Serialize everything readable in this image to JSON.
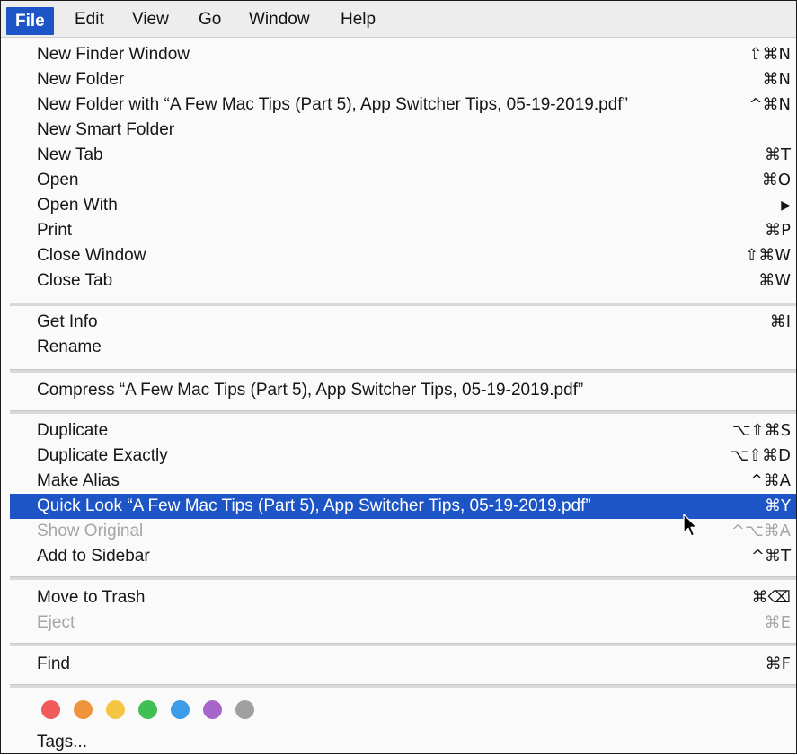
{
  "menubar": {
    "items": [
      "File",
      "Edit",
      "View",
      "Go",
      "Window",
      "Help"
    ],
    "active": "File"
  },
  "menu": {
    "items": [
      {
        "label": "New Finder Window",
        "shortcut": "⇧⌘N"
      },
      {
        "label": "New Folder",
        "shortcut": "⌘N"
      },
      {
        "label": "New Folder with “A Few Mac Tips (Part 5), App Switcher Tips, 05-19-2019.pdf”",
        "shortcut": "^⌘N"
      },
      {
        "label": "New Smart Folder",
        "shortcut": ""
      },
      {
        "label": "New Tab",
        "shortcut": "⌘T"
      },
      {
        "label": "Open",
        "shortcut": "⌘O"
      },
      {
        "label": "Open With",
        "shortcut": "▶"
      },
      {
        "label": "Print",
        "shortcut": "⌘P"
      },
      {
        "label": "Close Window",
        "shortcut": "⇧⌘W"
      },
      {
        "label": "Close Tab",
        "shortcut": "⌘W"
      },
      {
        "label": "Get Info",
        "shortcut": "⌘I"
      },
      {
        "label": "Rename",
        "shortcut": ""
      },
      {
        "label": "Compress “A Few Mac Tips (Part 5), App Switcher Tips, 05-19-2019.pdf”",
        "shortcut": ""
      },
      {
        "label": "Duplicate",
        "shortcut": "⌥⇧⌘S"
      },
      {
        "label": "Duplicate Exactly",
        "shortcut": "⌥⇧⌘D"
      },
      {
        "label": "Make Alias",
        "shortcut": "^⌘A"
      },
      {
        "label": "Quick Look “A Few Mac Tips (Part 5), App Switcher Tips, 05-19-2019.pdf”",
        "shortcut": "⌘Y",
        "state": "highlighted"
      },
      {
        "label": "Show Original",
        "shortcut": "^⌥⌘A",
        "state": "disabled"
      },
      {
        "label": "Add to Sidebar",
        "shortcut": "^⌘T"
      },
      {
        "label": "Move to Trash",
        "shortcut": "⌘⌫"
      },
      {
        "label": "Eject",
        "shortcut": "⌘E",
        "state": "disabled"
      },
      {
        "label": "Find",
        "shortcut": "⌘F"
      },
      {
        "label": "Tags...",
        "shortcut": ""
      }
    ]
  },
  "tag_colors": [
    "#f05a5a",
    "#f0943c",
    "#f5c542",
    "#3fbf54",
    "#3c9ce8",
    "#a865c9",
    "#a0a0a0"
  ],
  "colors": {
    "highlight": "#1d55c7"
  },
  "icons": {
    "cursor": "arrow-pointer-icon"
  }
}
